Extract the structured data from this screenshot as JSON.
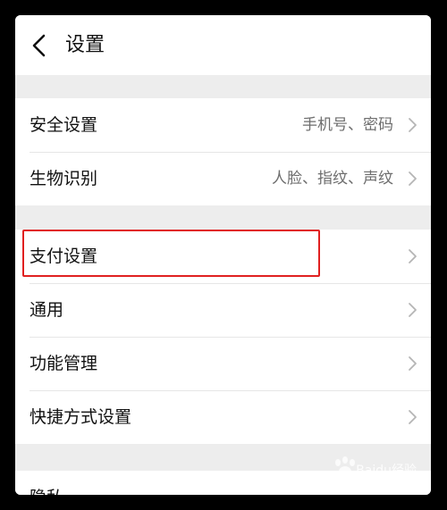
{
  "header": {
    "title": "设置"
  },
  "groups": [
    {
      "items": [
        {
          "label": "安全设置",
          "value": "手机号、密码"
        },
        {
          "label": "生物识别",
          "value": "人脸、指纹、声纹"
        }
      ]
    },
    {
      "items": [
        {
          "label": "支付设置",
          "value": ""
        },
        {
          "label": "通用",
          "value": ""
        },
        {
          "label": "功能管理",
          "value": ""
        },
        {
          "label": "快捷方式设置",
          "value": ""
        }
      ]
    },
    {
      "items": [
        {
          "label": "隐私",
          "value": ""
        }
      ]
    }
  ],
  "colors": {
    "highlight": "#e02020",
    "page_bg": "#ededed",
    "divider": "#e6e6e6"
  },
  "icons": {
    "back": "chevron-left-icon",
    "row_arrow": "chevron-right-icon"
  },
  "watermark": {
    "brand": "Baidu经验",
    "url": "jingyan.baidu.com"
  }
}
